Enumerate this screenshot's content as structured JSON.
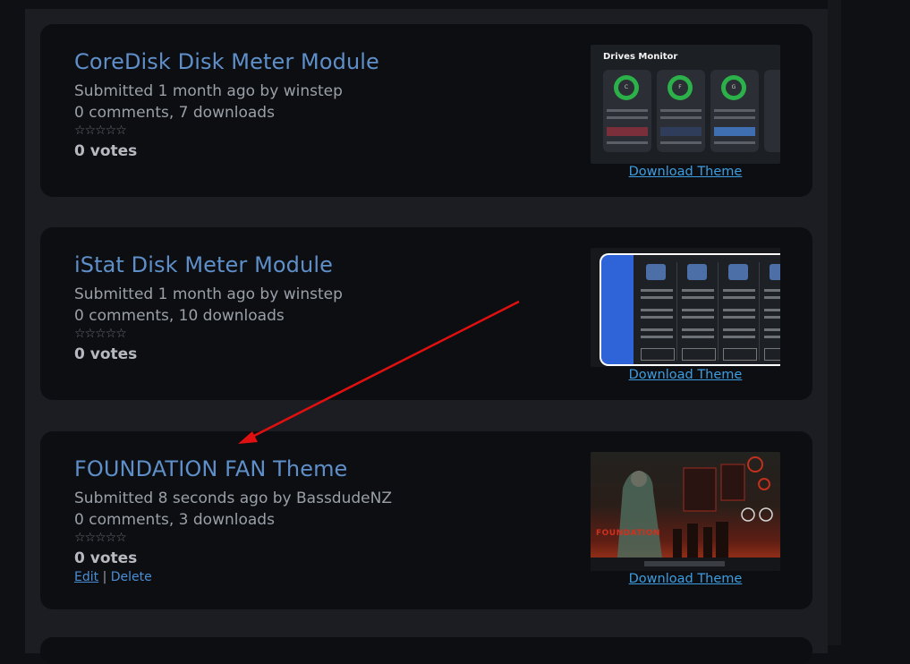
{
  "items": [
    {
      "title": "CoreDisk Disk Meter Module",
      "submitted": "Submitted 1 month ago by winstep",
      "stats": "0 comments, 7 downloads",
      "stars": "☆☆☆☆☆",
      "votes": "0 votes",
      "download_label": "Download Theme",
      "thumbnail": {
        "header": "Drives Monitor",
        "drives": [
          "C",
          "F",
          "G"
        ],
        "ring_color": "#2bb04a"
      }
    },
    {
      "title": "iStat Disk Meter Module",
      "submitted": "Submitted 1 month ago by winstep",
      "stats": "0 comments, 10 downloads",
      "stars": "☆☆☆☆☆",
      "votes": "0 votes",
      "download_label": "Download Theme",
      "thumbnail": {
        "accent": "#2f64d8"
      }
    },
    {
      "title": "FOUNDATION FAN Theme",
      "submitted": "Submitted 8 seconds ago by BassdudeNZ",
      "stats": "0 comments, 3 downloads",
      "stars": "☆☆☆☆☆",
      "votes": "0 votes",
      "download_label": "Download Theme",
      "edit_label": "Edit",
      "separator": "|",
      "delete_label": "Delete",
      "thumbnail": {
        "logo_text": "FOUNDATION",
        "accent": "#c0301c"
      }
    }
  ],
  "colors": {
    "title": "#5e8fc9",
    "link": "#3d9de0",
    "annotation_arrow": "#e01010"
  },
  "icons": {
    "star": "star-outline-icon"
  }
}
